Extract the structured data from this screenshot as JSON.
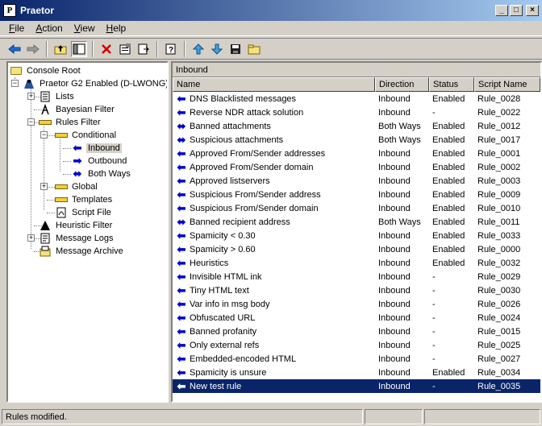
{
  "window": {
    "title": "Praetor",
    "icon_letter": "P"
  },
  "titlebar_buttons": {
    "minimize": "_",
    "maximize": "□",
    "close": "×"
  },
  "menu": [
    {
      "label": "File",
      "hot": "F",
      "rest": "ile"
    },
    {
      "label": "Action",
      "hot": "A",
      "rest": "ction"
    },
    {
      "label": "View",
      "hot": "V",
      "rest": "iew"
    },
    {
      "label": "Help",
      "hot": "H",
      "rest": "elp"
    }
  ],
  "toolbar": [
    "back-arrow-icon",
    "forward-arrow-icon",
    "up-folder-icon",
    "show-tree-icon",
    "delete-icon",
    "properties-icon",
    "export-icon",
    "help-icon",
    "move-up-icon",
    "move-down-icon",
    "save-icon",
    "new-folder-icon"
  ],
  "tree": {
    "console_root": "Console Root",
    "server": "Praetor G2 Enabled (D-LWONG)",
    "lists": "Lists",
    "bayesian": "Bayesian Filter",
    "rules_filter": "Rules Filter",
    "conditional": "Conditional",
    "inbound": "Inbound",
    "outbound": "Outbound",
    "both_ways": "Both Ways",
    "global": "Global",
    "templates": "Templates",
    "script_file": "Script File",
    "heuristic": "Heuristic Filter",
    "message_logs": "Message Logs",
    "message_archive": "Message Archive"
  },
  "panel": {
    "caption": "Inbound"
  },
  "columns": {
    "name": "Name",
    "direction": "Direction",
    "status": "Status",
    "script": "Script Name"
  },
  "rows": [
    {
      "name": "DNS Blacklisted messages",
      "direction": "Inbound",
      "status": "Enabled",
      "script": "Rule_0028",
      "icon": "left-arrow-icon"
    },
    {
      "name": "Reverse NDR attack solution",
      "direction": "Inbound",
      "status": "-",
      "script": "Rule_0022",
      "icon": "left-arrow-icon"
    },
    {
      "name": "Banned attachments",
      "direction": "Both Ways",
      "status": "Enabled",
      "script": "Rule_0012",
      "icon": "both-arrow-icon"
    },
    {
      "name": "Suspicious attachments",
      "direction": "Both Ways",
      "status": "Enabled",
      "script": "Rule_0017",
      "icon": "both-arrow-icon"
    },
    {
      "name": "Approved From/Sender addresses",
      "direction": "Inbound",
      "status": "Enabled",
      "script": "Rule_0001",
      "icon": "left-arrow-icon"
    },
    {
      "name": "Approved From/Sender domain",
      "direction": "Inbound",
      "status": "Enabled",
      "script": "Rule_0002",
      "icon": "left-arrow-icon"
    },
    {
      "name": "Approved listservers",
      "direction": "Inbound",
      "status": "Enabled",
      "script": "Rule_0003",
      "icon": "left-arrow-icon"
    },
    {
      "name": "Suspicious From/Sender address",
      "direction": "Inbound",
      "status": "Enabled",
      "script": "Rule_0009",
      "icon": "left-arrow-icon"
    },
    {
      "name": "Suspicious From/Sender domain",
      "direction": "Inbound",
      "status": "Enabled",
      "script": "Rule_0010",
      "icon": "left-arrow-icon"
    },
    {
      "name": "Banned recipient address",
      "direction": "Both Ways",
      "status": "Enabled",
      "script": "Rule_0011",
      "icon": "both-arrow-icon"
    },
    {
      "name": "Spamicity < 0.30",
      "direction": "Inbound",
      "status": "Enabled",
      "script": "Rule_0033",
      "icon": "left-arrow-icon"
    },
    {
      "name": "Spamicity > 0.60",
      "direction": "Inbound",
      "status": "Enabled",
      "script": "Rule_0000",
      "icon": "left-arrow-icon"
    },
    {
      "name": "Heuristics",
      "direction": "Inbound",
      "status": "Enabled",
      "script": "Rule_0032",
      "icon": "left-arrow-icon"
    },
    {
      "name": "Invisible HTML ink",
      "direction": "Inbound",
      "status": "-",
      "script": "Rule_0029",
      "icon": "left-arrow-icon"
    },
    {
      "name": "Tiny HTML text",
      "direction": "Inbound",
      "status": "-",
      "script": "Rule_0030",
      "icon": "left-arrow-icon"
    },
    {
      "name": "Var info in msg body",
      "direction": "Inbound",
      "status": "-",
      "script": "Rule_0026",
      "icon": "left-arrow-icon"
    },
    {
      "name": "Obfuscated URL",
      "direction": "Inbound",
      "status": "-",
      "script": "Rule_0024",
      "icon": "left-arrow-icon"
    },
    {
      "name": "Banned profanity",
      "direction": "Inbound",
      "status": "-",
      "script": "Rule_0015",
      "icon": "left-arrow-icon"
    },
    {
      "name": "Only external refs",
      "direction": "Inbound",
      "status": "-",
      "script": "Rule_0025",
      "icon": "left-arrow-icon"
    },
    {
      "name": "Embedded-encoded HTML",
      "direction": "Inbound",
      "status": "-",
      "script": "Rule_0027",
      "icon": "left-arrow-icon"
    },
    {
      "name": "Spamicity is unsure",
      "direction": "Inbound",
      "status": "Enabled",
      "script": "Rule_0034",
      "icon": "left-arrow-icon"
    },
    {
      "name": "New test rule",
      "direction": "Inbound",
      "status": "-",
      "script": "Rule_0035",
      "icon": "left-arrow-icon",
      "selected": true
    }
  ],
  "status": {
    "text": "Rules modified."
  }
}
